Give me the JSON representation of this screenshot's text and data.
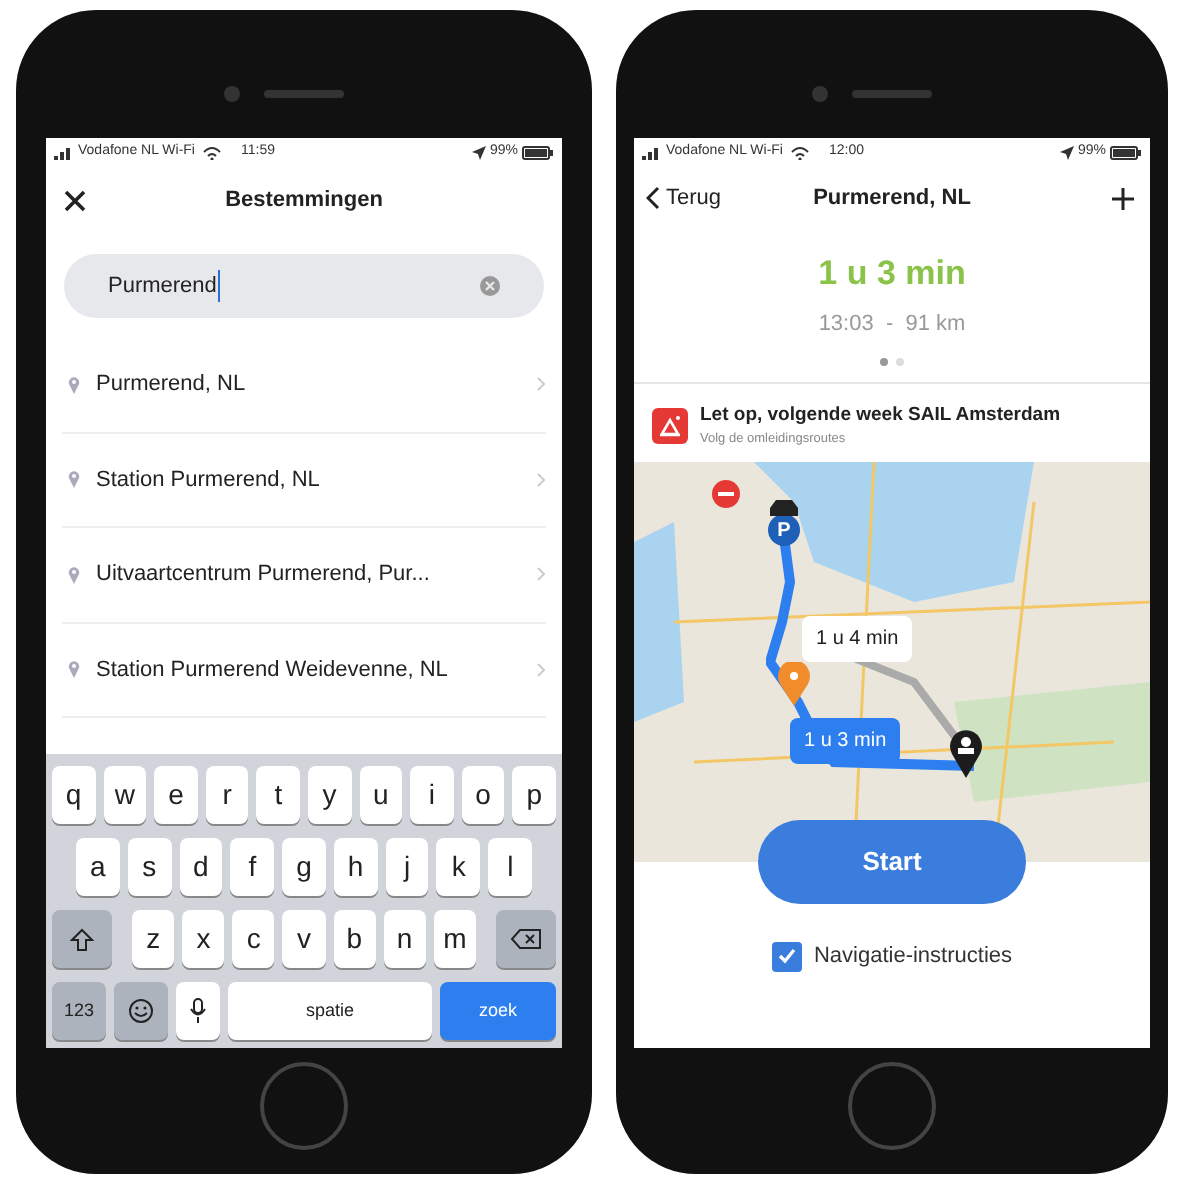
{
  "phones": [
    {
      "status_bar": {
        "carrier": "Vodafone NL Wi-Fi",
        "time": "11:59",
        "battery": "99%"
      },
      "header": {
        "title": "Bestemmingen"
      },
      "search": {
        "value": "Purmerend"
      },
      "results": [
        {
          "label": "Purmerend, NL"
        },
        {
          "label": "Station Purmerend, NL"
        },
        {
          "label": "Uitvaartcentrum Purmerend, Pur..."
        },
        {
          "label": "Station Purmerend Weidevenne, NL"
        }
      ],
      "keyboard": [
        [
          {
            "kind": "letter",
            "label": "q"
          },
          {
            "kind": "letter",
            "label": "w"
          },
          {
            "kind": "letter",
            "label": "e"
          },
          {
            "kind": "letter",
            "label": "r"
          },
          {
            "kind": "letter",
            "label": "t"
          },
          {
            "kind": "letter",
            "label": "y"
          },
          {
            "kind": "letter",
            "label": "u"
          },
          {
            "kind": "letter",
            "label": "i"
          },
          {
            "kind": "letter",
            "label": "o"
          },
          {
            "kind": "letter",
            "label": "p"
          }
        ],
        [
          {
            "kind": "letter",
            "label": "a"
          },
          {
            "kind": "letter",
            "label": "s"
          },
          {
            "kind": "letter",
            "label": "d"
          },
          {
            "kind": "letter",
            "label": "f"
          },
          {
            "kind": "letter",
            "label": "g"
          },
          {
            "kind": "letter",
            "label": "h"
          },
          {
            "kind": "letter",
            "label": "j"
          },
          {
            "kind": "letter",
            "label": "k"
          },
          {
            "kind": "letter",
            "label": "l"
          }
        ],
        [
          {
            "kind": "shift"
          },
          {
            "kind": "letter",
            "label": "z"
          },
          {
            "kind": "letter",
            "label": "x"
          },
          {
            "kind": "letter",
            "label": "c"
          },
          {
            "kind": "letter",
            "label": "v"
          },
          {
            "kind": "letter",
            "label": "b"
          },
          {
            "kind": "letter",
            "label": "n"
          },
          {
            "kind": "letter",
            "label": "m"
          },
          {
            "kind": "backspace"
          }
        ],
        [
          {
            "kind": "numbers",
            "label": "123"
          },
          {
            "kind": "emoji"
          },
          {
            "kind": "mic"
          },
          {
            "kind": "space",
            "label": "spatie"
          },
          {
            "kind": "search",
            "label": "zoek"
          }
        ]
      ]
    },
    {
      "status_bar": {
        "carrier": "Vodafone NL Wi-Fi",
        "time": "12:00",
        "battery": "99%"
      },
      "header": {
        "back": "Terug",
        "title": "Purmerend, NL"
      },
      "route": {
        "duration": "1 u 3 min",
        "details": "13:03  -  91 km",
        "pages": [
          {
            "selected": true
          },
          {
            "selected": false
          }
        ]
      },
      "alert": {
        "title": "Let op, volgende week SAIL Amsterdam",
        "subtitle": "Volg de omleidingsroutes"
      },
      "map": {
        "parking_label": "P",
        "routes": [
          {
            "label": "1 u 4 min",
            "selected": false
          },
          {
            "label": "1 u 3 min",
            "selected": true
          }
        ]
      },
      "start_button": "Start",
      "option": {
        "label": "Navigatie-instructies",
        "checked": true
      }
    }
  ]
}
